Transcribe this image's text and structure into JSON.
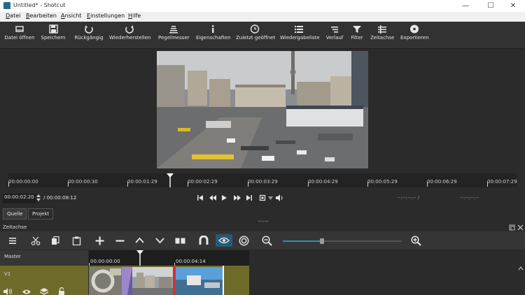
{
  "window": {
    "title": "Untitled* - Shotcut",
    "minimize": "—",
    "maximize": "☐",
    "close": "✕"
  },
  "menu": [
    {
      "label": "Datei",
      "accel": "D",
      "rest": "atei"
    },
    {
      "label": "Bearbeiten",
      "accel": "B",
      "rest": "earbeiten"
    },
    {
      "label": "Ansicht",
      "accel": "A",
      "rest": "nsicht"
    },
    {
      "label": "Einstellungen",
      "accel": "E",
      "rest": "instellungen"
    },
    {
      "label": "Hilfe",
      "accel": "H",
      "rest": "ilfe"
    }
  ],
  "toolbar": [
    {
      "label": "Datei öffnen",
      "icon": "open-file-icon"
    },
    {
      "label": "Speichern",
      "icon": "save-icon"
    },
    {
      "label": "Rückgängig",
      "icon": "undo-icon"
    },
    {
      "label": "Wiederherstellen",
      "icon": "redo-icon"
    },
    {
      "label": "Pegelmesser",
      "icon": "audio-meter-icon"
    },
    {
      "label": "Eigenschaften",
      "icon": "properties-icon"
    },
    {
      "label": "Zuletzt geöffnet",
      "icon": "recent-icon"
    },
    {
      "label": "Wiedergabeliste",
      "icon": "playlist-icon"
    },
    {
      "label": "Verlauf",
      "icon": "history-icon"
    },
    {
      "label": "Filter",
      "icon": "filter-icon"
    },
    {
      "label": "Zeitachse",
      "icon": "timeline-icon"
    },
    {
      "label": "Exportieren",
      "icon": "export-icon"
    }
  ],
  "ruler": {
    "labels": [
      "00:00:00:00",
      "00:00:00:30",
      "00:00:01:29",
      "00:00:02:29",
      "00:00:03:29",
      "00:00:04:29",
      "00:00:05:29",
      "00:00:06:29",
      "00:00:07:29"
    ]
  },
  "transport": {
    "position": "00:00:02:20",
    "duration": "/ 00:00:08:12",
    "in_point": "--:--:--:-- /",
    "out_point": "--:--:--:--"
  },
  "tabs": {
    "source": "Quelle",
    "project": "Projekt"
  },
  "timeline": {
    "title": "Zeitachse",
    "master_label": "Master",
    "v1_label": "V1",
    "ruler_start": "00:00:00:00",
    "ruler_mid": "00:00:04:14"
  },
  "colors": {
    "accent": "#2a8fb5",
    "track": "#6e6a2a",
    "playhead": "#ffffff"
  }
}
